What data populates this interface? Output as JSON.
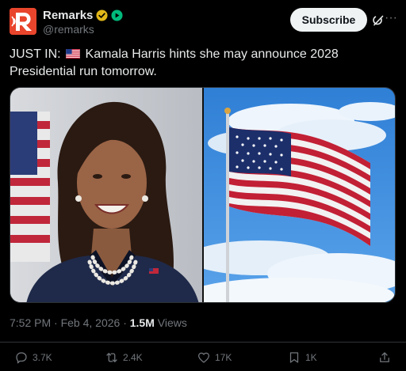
{
  "account": {
    "name": "Remarks",
    "handle": "@remarks",
    "avatar_letter": "R",
    "brand_color": "#e8452c",
    "verified_badge_color": "#e2b719"
  },
  "header": {
    "subscribe_label": "Subscribe",
    "more_label": "···"
  },
  "post": {
    "prefix": "JUST IN:",
    "text": "Kamala Harris hints she may announce 2028 Presidential run tomorrow."
  },
  "meta": {
    "time_date": "7:52 PM · Feb 4, 2026 · ",
    "views_count": "1.5M",
    "views_label": " Views"
  },
  "actions": {
    "replies": "3.7K",
    "reposts": "2.4K",
    "likes": "17K",
    "bookmarks": "1K"
  }
}
